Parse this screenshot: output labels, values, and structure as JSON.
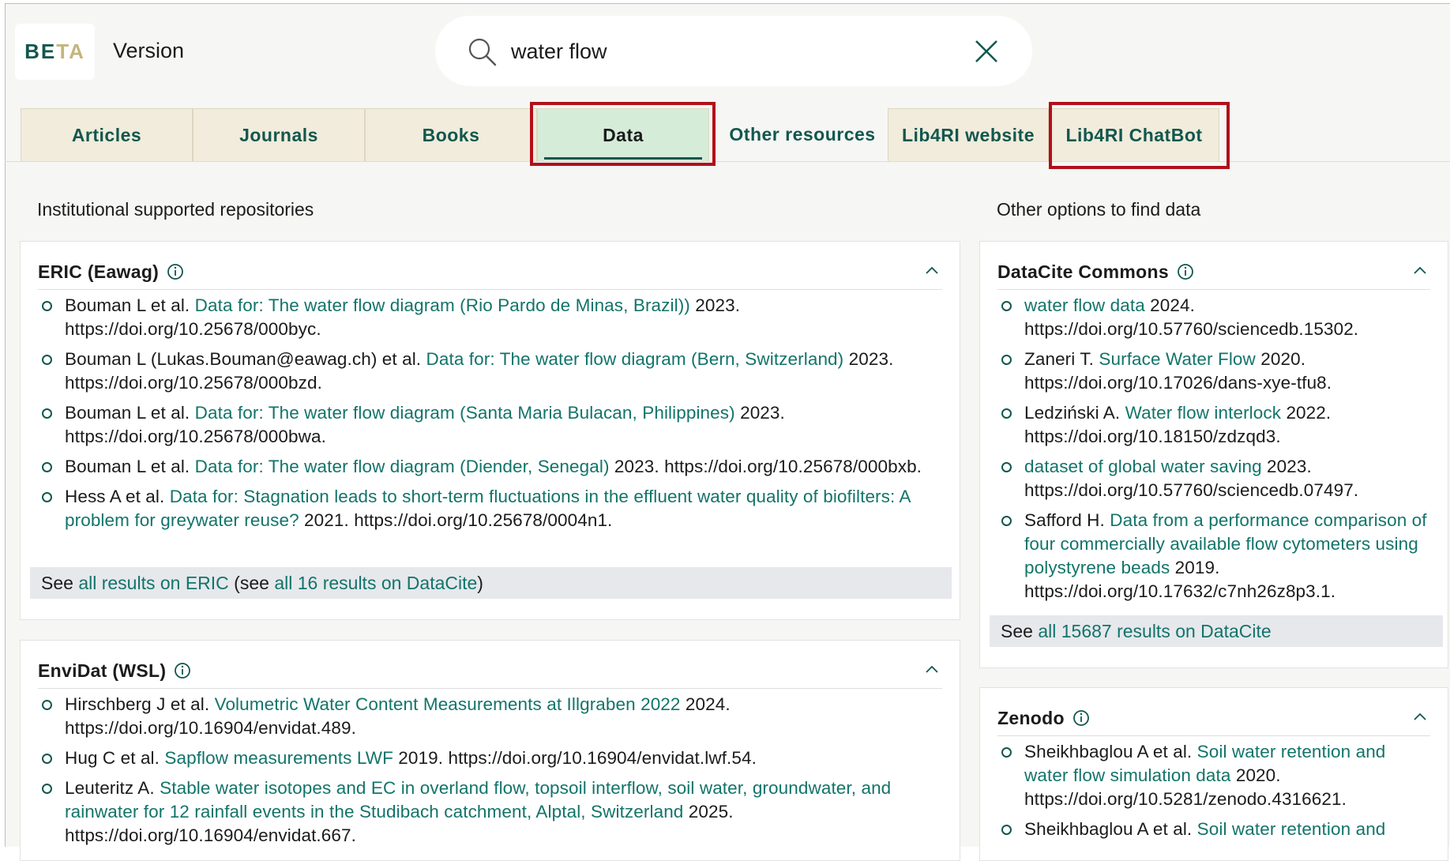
{
  "header": {
    "logo_be": "BE",
    "logo_ta": "TA",
    "version_label": "Version",
    "search_value": "water flow"
  },
  "tabs": [
    {
      "label": "Articles"
    },
    {
      "label": "Journals"
    },
    {
      "label": "Books"
    },
    {
      "label": "Data",
      "active": true
    },
    {
      "label": "Other resources"
    },
    {
      "label": "Lib4RI website"
    },
    {
      "label": "Lib4RI ChatBot"
    }
  ],
  "left": {
    "heading": "Institutional supported repositories",
    "eric": {
      "title": "ERIC (Eawag)",
      "items": [
        {
          "pre": "Bouman L et al. ",
          "link": "Data for: The water flow diagram (Rio Pardo de Minas, Brazil))",
          "post": " 2023. https://doi.org/10.25678/000byc."
        },
        {
          "pre": "Bouman L (Lukas.Bouman@eawag.ch) et al. ",
          "link": "Data for: The water flow diagram (Bern, Switzerland)",
          "post": " 2023. https://doi.org/10.25678/000bzd."
        },
        {
          "pre": "Bouman L et al. ",
          "link": "Data for: The water flow diagram (Santa Maria Bulacan, Philippines)",
          "post": " 2023. https://doi.org/10.25678/000bwa."
        },
        {
          "pre": "Bouman L et al. ",
          "link": "Data for: The water flow diagram (Diender, Senegal)",
          "post": " 2023. https://doi.org/10.25678/000bxb."
        },
        {
          "pre": "Hess A et al. ",
          "link": "Data for: Stagnation leads to short-term fluctuations in the effluent water quality of biofilters: A problem for greywater reuse?",
          "post": " 2021. https://doi.org/10.25678/0004n1."
        }
      ],
      "see_pre": "See ",
      "see_link1": "all results on ERIC",
      "see_mid": " (see ",
      "see_link2": "all 16 results on DataCite",
      "see_post": ")"
    },
    "envidat": {
      "title": "EnviDat (WSL)",
      "items": [
        {
          "pre": "Hirschberg J et al. ",
          "link": "Volumetric Water Content Measurements at Illgraben 2022",
          "post": " 2024. https://doi.org/10.16904/envidat.489."
        },
        {
          "pre": "Hug C et al. ",
          "link": "Sapflow measurements LWF",
          "post": " 2019. https://doi.org/10.16904/envidat.lwf.54."
        },
        {
          "pre": "Leuteritz A. ",
          "link": "Stable water isotopes and EC in overland flow, topsoil interflow, soil water, groundwater, and rainwater for 12 rainfall events in the Studibach catchment, Alptal, Switzerland",
          "post": " 2025. https://doi.org/10.16904/envidat.667."
        }
      ]
    }
  },
  "right": {
    "heading": "Other options to find data",
    "datacite": {
      "title": "DataCite Commons",
      "items": [
        {
          "pre": "",
          "link": "water flow data",
          "post": " 2024. https://doi.org/10.57760/sciencedb.15302."
        },
        {
          "pre": "Zaneri T. ",
          "link": "Surface Water Flow",
          "post": " 2020. https://doi.org/10.17026/dans-xye-tfu8."
        },
        {
          "pre": "Ledziński A. ",
          "link": "Water flow interlock",
          "post": " 2022. https://doi.org/10.18150/zdzqd3."
        },
        {
          "pre": "",
          "link": "dataset of global water saving",
          "post": " 2023. https://doi.org/10.57760/sciencedb.07497."
        },
        {
          "pre": "Safford H. ",
          "link": "Data from a performance comparison of four commercially available flow cytometers using polystyrene beads",
          "post": " 2019. https://doi.org/10.17632/c7nh26z8p3.1."
        }
      ],
      "see_pre": "See ",
      "see_link": "all 15687 results on DataCite"
    },
    "zenodo": {
      "title": "Zenodo",
      "items": [
        {
          "pre": "Sheikhbaglou A et al. ",
          "link": "Soil water retention and water flow simulation data",
          "post": " 2020. https://doi.org/10.5281/zenodo.4316621."
        },
        {
          "pre": "Sheikhbaglou A et al. ",
          "link": "Soil water retention and",
          "post": ""
        }
      ]
    }
  },
  "colors": {
    "accent": "#12574e",
    "link": "#12746a",
    "highlight": "#b1101a",
    "tab_bg": "#f1ecdc",
    "tab_active_bg": "#d5ecd9"
  }
}
